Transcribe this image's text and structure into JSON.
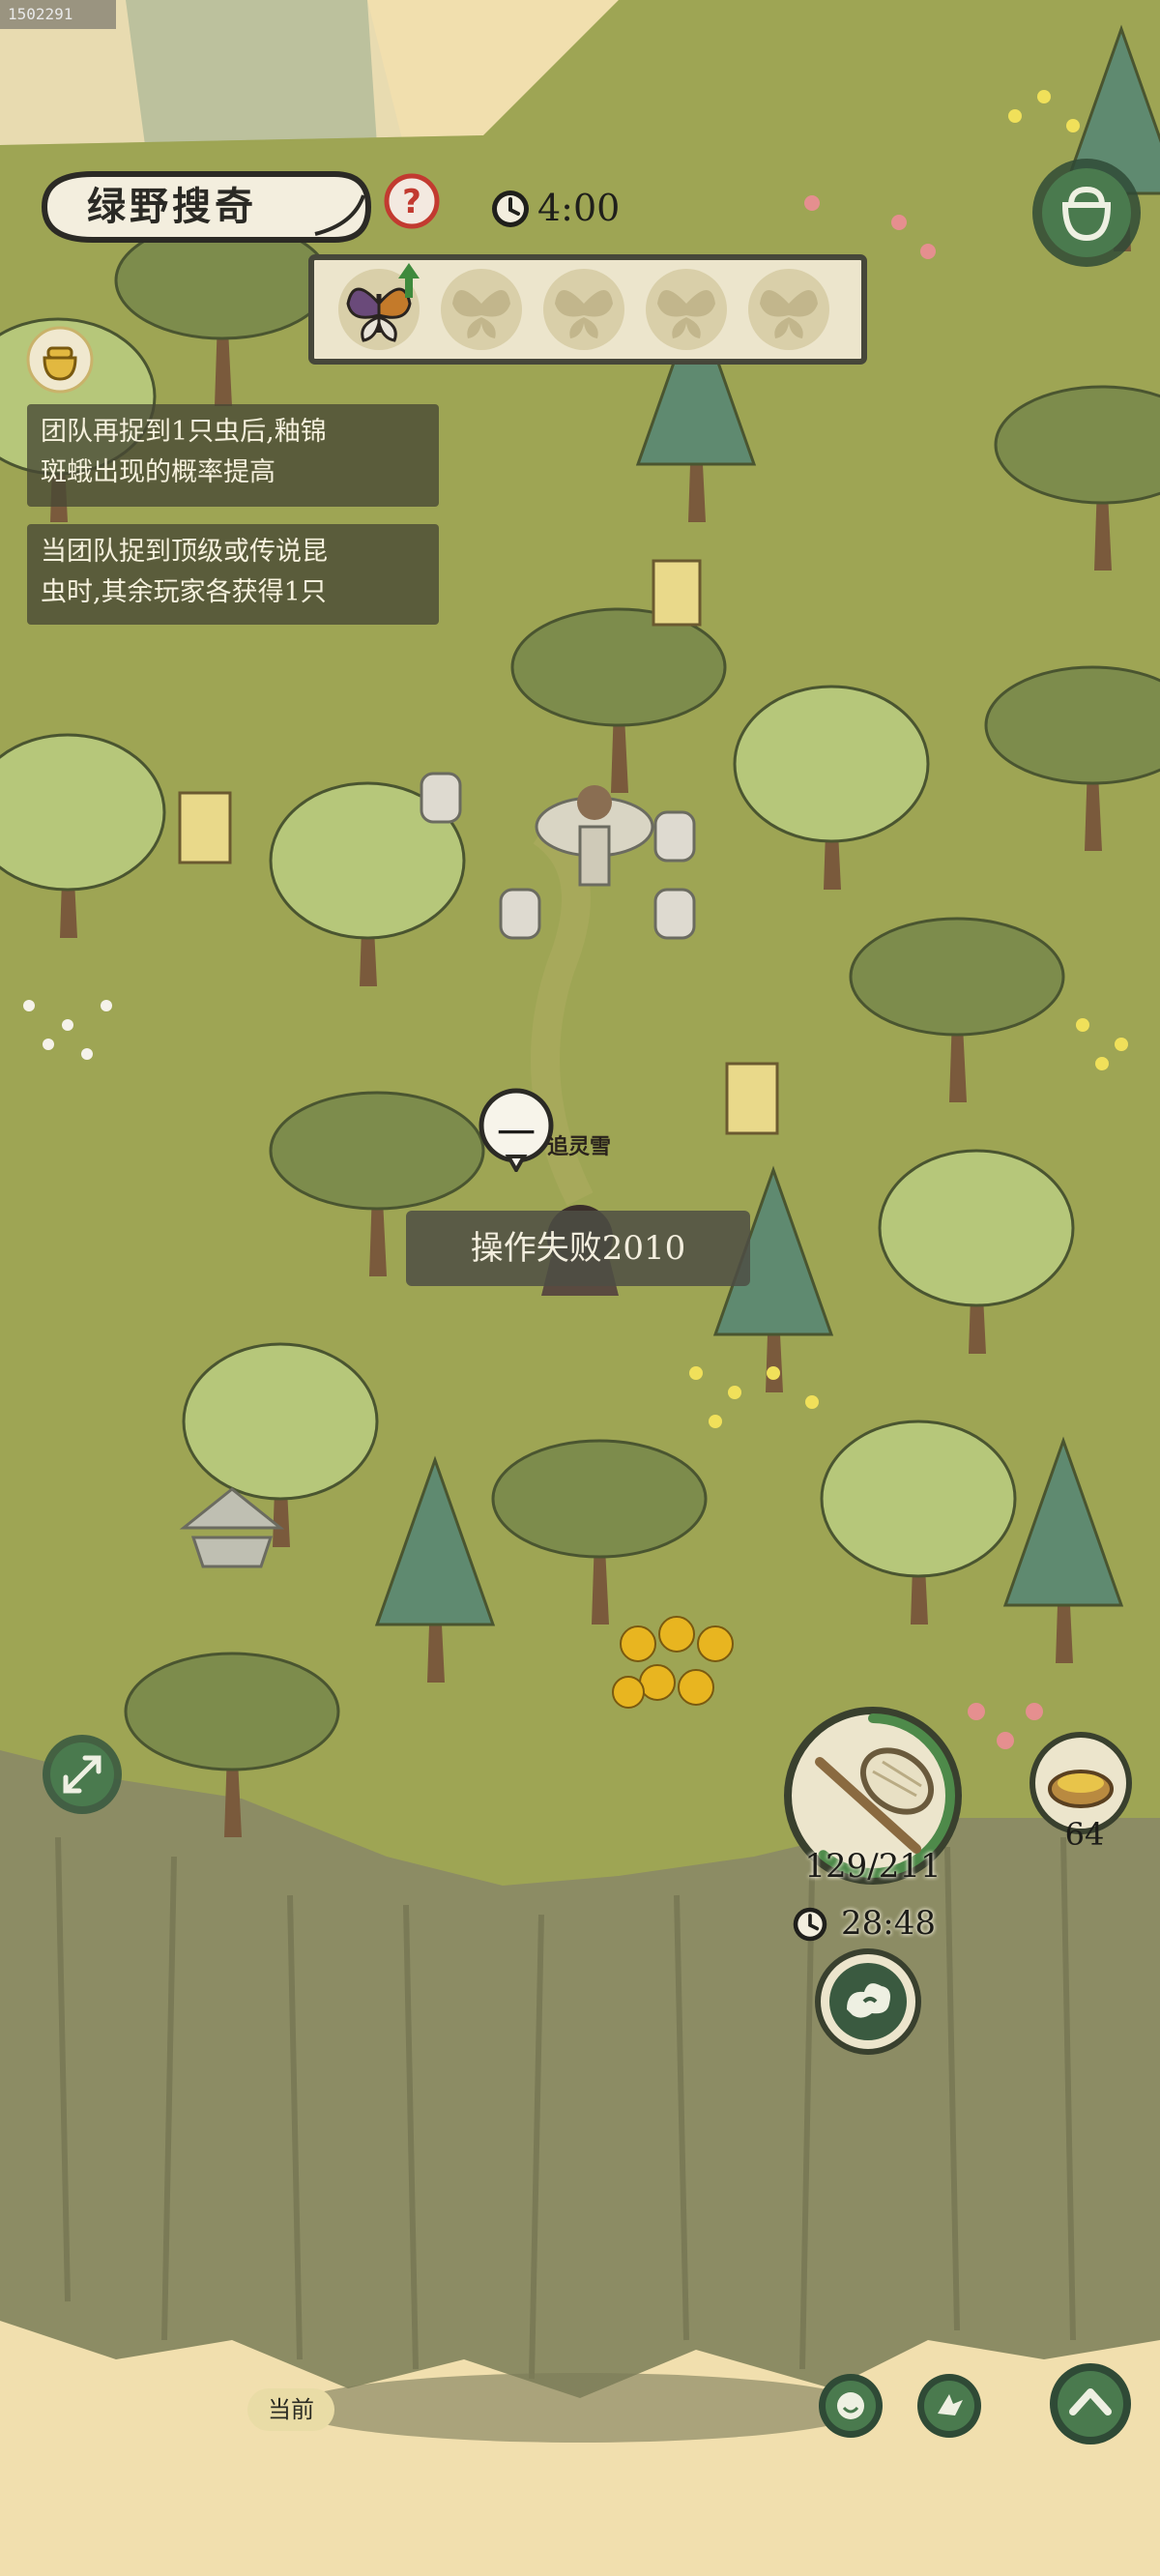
{
  "screen_id": "1502291",
  "event": {
    "title": "绿野搜奇",
    "help_icon": "question-mark-icon",
    "timer_icon": "clock-icon",
    "time_left": "4:00"
  },
  "tracker": {
    "slots": [
      {
        "state": "found",
        "icon": "butterfly-icon",
        "boost_icon": "up-arrow-icon"
      },
      {
        "state": "empty",
        "icon": "butterfly-silhouette-icon"
      },
      {
        "state": "empty",
        "icon": "butterfly-silhouette-icon"
      },
      {
        "state": "empty",
        "icon": "butterfly-silhouette-icon"
      },
      {
        "state": "empty",
        "icon": "butterfly-silhouette-icon"
      }
    ]
  },
  "info": {
    "line1": "团队再捉到1只虫后,釉锦",
    "line2": "斑蛾出现的概率提高",
    "line3": "当团队捉到顶级或传说昆",
    "line4": "虫时,其余玩家各获得1只"
  },
  "side_icon": "pot-icon",
  "bag_icon": "bag-icon",
  "player": {
    "name": "追灵雪",
    "speech": "一"
  },
  "toast": "操作失败2010",
  "net": {
    "icon": "butterfly-net-icon",
    "durability": "129/211",
    "durability_fraction": 0.611,
    "timer_icon": "clock-icon",
    "time": "28:48"
  },
  "skill_icon": "cloud-swirl-icon",
  "bait": {
    "icon": "bait-bowl-icon",
    "count": "64"
  },
  "expand_icon": "expand-arrows-icon",
  "location_label": "当前",
  "bottom_buttons": {
    "emote_icon": "smile-icon",
    "action_icon": "hand-icon",
    "up_icon": "chevron-up-icon"
  },
  "colors": {
    "grass": "#9ba452",
    "cliff": "#8c8c64",
    "sand": "#f1dfae",
    "panel": "#464834",
    "accent_green": "#4a7a4e"
  }
}
